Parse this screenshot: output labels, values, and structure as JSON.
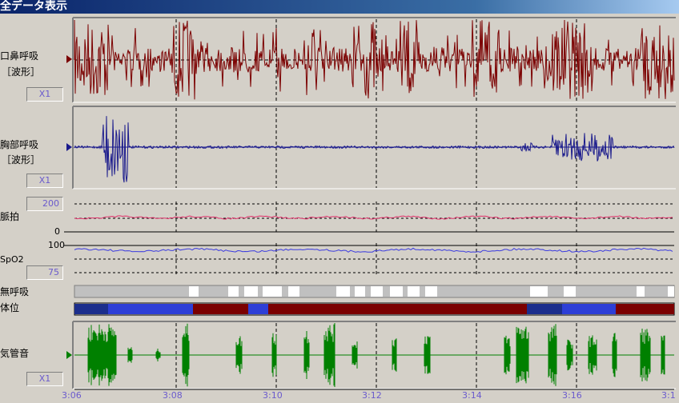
{
  "window": {
    "title": "全データ表示"
  },
  "channels": {
    "oronasal": {
      "label1": "口鼻呼吸",
      "label2": "［波形］",
      "scale": "X1",
      "color": "#7b0000"
    },
    "chest": {
      "label1": "胸部呼吸",
      "label2": "［波形］",
      "scale": "X1",
      "color": "#1a1a8c"
    },
    "pulse": {
      "label": "脈拍",
      "max": "200",
      "min": "0",
      "color": "#e0306a"
    },
    "spo2": {
      "label": "SpO2",
      "max": "100",
      "min": "75",
      "color": "#3a3ae0"
    },
    "apnea": {
      "label": "無呼吸"
    },
    "position": {
      "label": "体位"
    },
    "tracheal": {
      "label": "気管音",
      "scale": "X1",
      "color": "#008000"
    }
  },
  "time_axis": {
    "ticks": [
      "3:06",
      "3:08",
      "3:10",
      "3:12",
      "3:14",
      "3:16",
      "3:1"
    ]
  }
}
